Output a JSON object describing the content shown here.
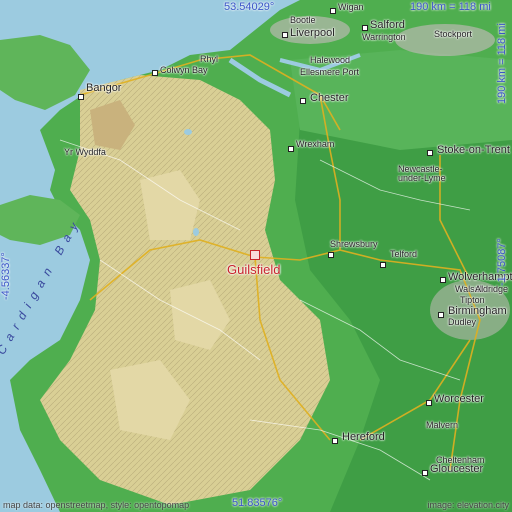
{
  "map": {
    "place": "Guilsfield",
    "coords": {
      "top": "53.54029°",
      "bottom": "51.83576°",
      "left": "-4.56337°",
      "right": "-1.75087°"
    },
    "scale_top": "190 km = 118 mi",
    "scale_right": "190 km = 118 mi",
    "sea_label": "Cardigan Bay",
    "attribution_left": "map data: openstreetmap, style: opentopomap",
    "attribution_right": "image: elevation.city",
    "cities": {
      "wigan": "Wigan",
      "bootle": "Bootle",
      "salford": "Salford",
      "liverpool": "Liverpool",
      "warrington": "Warrington",
      "stockport": "Stockport",
      "rhyl": "Rhyl",
      "colwyn_bay": "Colwyn Bay",
      "halewood": "Halewood",
      "ellesmere_port": "Ellesmere Port",
      "bangor": "Bangor",
      "chester": "Chester",
      "yr_wyddfa": "Yr Wyddfa",
      "wrexham": "Wrexham",
      "stoke": "Stoke-on-Trent",
      "newcastle": "Newcastle-under-Lyme",
      "shrewsbury": "Shrewsbury",
      "telford": "Telford",
      "wolverhampton": "Wolverhampton",
      "walsall": "Walsall",
      "aldridge": "Aldridge",
      "tipton": "Tipton",
      "birmingham": "Birmingham",
      "dudley": "Dudley",
      "worcester": "Worcester",
      "malvern": "Malvern",
      "hereford": "Hereford",
      "cheltenham": "Cheltenham",
      "gloucester": "Gloucester"
    }
  }
}
